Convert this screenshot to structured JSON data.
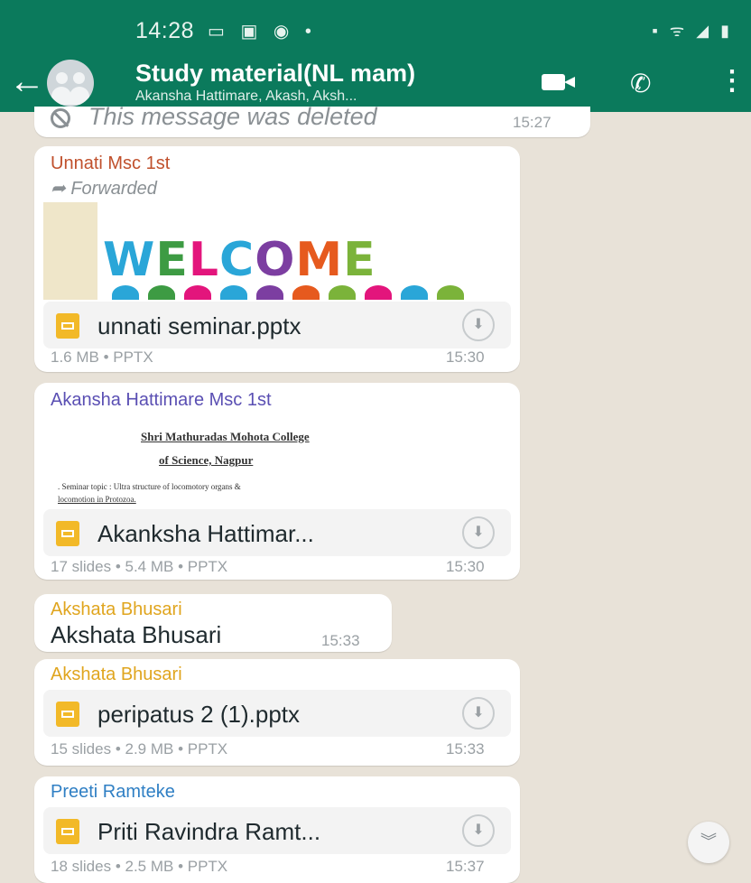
{
  "status_bar": {
    "time": "14:28",
    "left_icons": "▭ ▣ ◉ •",
    "right_icons": "▪ ᯤ ◢ ▮"
  },
  "header": {
    "back_icon": "arrow-left-icon",
    "title": "Study material(NL mam)",
    "subtitle": "Akansha Hattimare, Akash, Aksh...",
    "actions": [
      "video-call-icon",
      "voice-call-icon",
      "more-menu-icon"
    ]
  },
  "messages": [
    {
      "type": "deleted",
      "text": "This message was deleted",
      "time": "15:27"
    },
    {
      "type": "file",
      "sender": "Unnati Msc 1st",
      "sender_color": "#c0502c",
      "forwarded": "Forwarded",
      "preview": "WELCOME",
      "file_name": "unnati seminar.pptx",
      "meta": "1.6 MB • PPTX",
      "time": "15:30"
    },
    {
      "type": "file",
      "sender": "Akansha Hattimare Msc 1st",
      "sender_color": "#5a4fb3",
      "preview_lines": [
        "Shri Mathuradas Mohota College",
        "of Science, Nagpur",
        ". Seminar topic : Ultra structure of locomotory organs &",
        "locomotion in Protozoa."
      ],
      "file_name": "Akanksha Hattimar...",
      "meta": "17 slides • 5.4 MB • PPTX",
      "time": "15:30"
    },
    {
      "type": "text",
      "sender": "Akshata Bhusari",
      "sender_color": "#e0a51e",
      "text": "Akshata Bhusari",
      "time": "15:33"
    },
    {
      "type": "file",
      "sender": "Akshata Bhusari",
      "sender_color": "#e0a51e",
      "file_name": "peripatus 2 (1).pptx",
      "meta": "15 slides • 2.9 MB • PPTX",
      "time": "15:33"
    },
    {
      "type": "file",
      "sender": "Preeti Ramteke",
      "sender_color": "#2f7fc4",
      "file_name": "Priti Ravindra Ramt...",
      "meta": "18 slides • 2.5 MB • PPTX",
      "time": "15:37"
    }
  ],
  "scroll_button_icon": "chevrons-down-icon"
}
